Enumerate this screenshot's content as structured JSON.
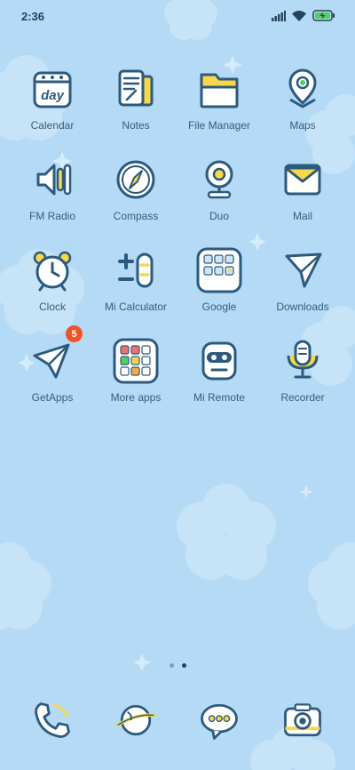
{
  "status": {
    "time": "2:36"
  },
  "apps": [
    {
      "label": "Calendar",
      "icon": "calendar-icon"
    },
    {
      "label": "Notes",
      "icon": "notes-icon"
    },
    {
      "label": "File Manager",
      "icon": "folder-icon"
    },
    {
      "label": "Maps",
      "icon": "map-pin-icon"
    },
    {
      "label": "FM Radio",
      "icon": "radio-icon"
    },
    {
      "label": "Compass",
      "icon": "compass-icon"
    },
    {
      "label": "Duo",
      "icon": "webcam-icon"
    },
    {
      "label": "Mail",
      "icon": "envelope-icon"
    },
    {
      "label": "Clock",
      "icon": "alarm-clock-icon"
    },
    {
      "label": "Mi Calculator",
      "icon": "calculator-icon"
    },
    {
      "label": "Google",
      "icon": "google-folder-icon"
    },
    {
      "label": "Downloads",
      "icon": "paper-plane-icon"
    },
    {
      "label": "GetApps",
      "icon": "paper-plane-icon",
      "badge": "5"
    },
    {
      "label": "More apps",
      "icon": "apps-folder-icon"
    },
    {
      "label": "Mi Remote",
      "icon": "robot-face-icon"
    },
    {
      "label": "Recorder",
      "icon": "microphone-icon"
    }
  ],
  "calendar_icon_text": "day",
  "dock": [
    {
      "icon": "phone-icon"
    },
    {
      "icon": "planet-browser-icon"
    },
    {
      "icon": "chat-bubble-icon"
    },
    {
      "icon": "camera-icon"
    }
  ],
  "colors": {
    "background": "#b4daf5",
    "outline": "#2c5a7e",
    "accent": "#f7d84a",
    "badge": "#f05424"
  }
}
